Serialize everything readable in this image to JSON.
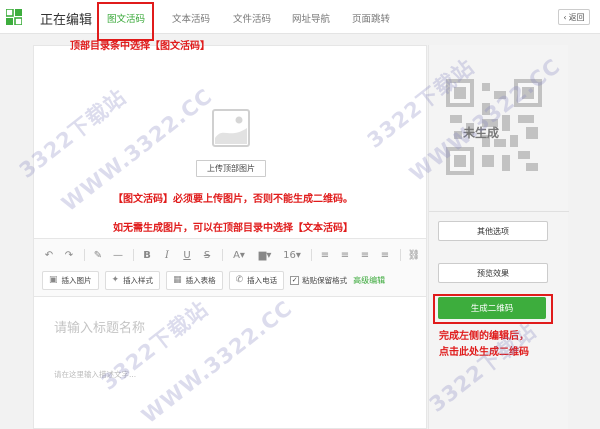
{
  "header": {
    "title": "正在编辑",
    "tabs": [
      {
        "label": "图文活码",
        "active": true
      },
      {
        "label": "文本活码",
        "active": false
      },
      {
        "label": "文件活码",
        "active": false
      },
      {
        "label": "网址导航",
        "active": false
      },
      {
        "label": "页面跳转",
        "active": false
      }
    ],
    "back_label": "返回",
    "logo_icon": "grid-logo-icon"
  },
  "annotations": {
    "top_hint": "顶部目录条中选择【图文活码】",
    "upload_hint": "【图文活码】必须要上传图片，否则不能生成二维码。",
    "text_hint": "如无需生成图片，可以在顶部目录中选择【文本活码】",
    "generate_hint_line1": "完成左侧的编辑后，",
    "generate_hint_line2": "点击此处生成二维码"
  },
  "editor": {
    "upload_label": "上传顶部图片",
    "font_size": "16",
    "insert_image": "插入图片",
    "insert_style": "插入样式",
    "insert_table": "插入表格",
    "insert_phone": "插入电话",
    "paste_keep_format": "粘贴保留格式",
    "advanced_edit": "高级编辑",
    "title_placeholder": "请输入标题名称",
    "desc_placeholder": "请在这里输入描述文字..."
  },
  "right_panel": {
    "qr_status": "未生成",
    "other_options": "其他选项",
    "preview": "预览效果",
    "generate": "生成二维码"
  },
  "watermark": {
    "site": "3322下载站",
    "url": "WWW.3322.CC"
  },
  "colors": {
    "accent_green": "#3dad3d",
    "annotation_red": "#e01b1b"
  }
}
